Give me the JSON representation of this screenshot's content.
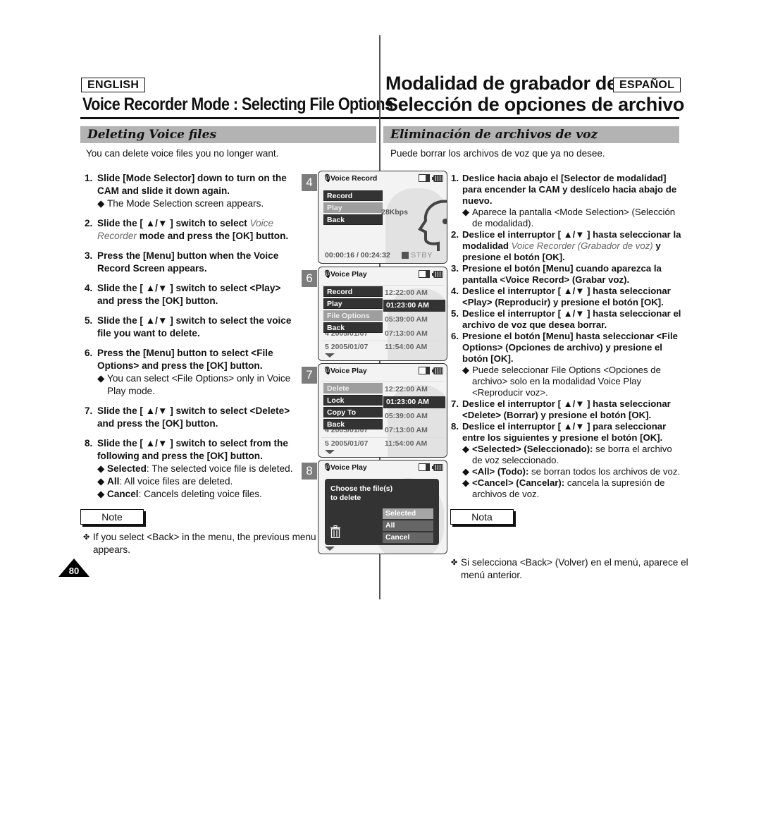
{
  "header": {
    "english_label": "ENGLISH",
    "spanish_label": "ESPAÑOL",
    "title_en": "Voice Recorder Mode : Selecting File Options",
    "title_es_line1": "Modalidad de grabador de voz:",
    "title_es_line2": "Selección de opciones de archivo"
  },
  "english": {
    "section_title": "Deleting Voice files",
    "intro": "You can delete voice files you no longer want.",
    "steps": [
      {
        "num": "1.",
        "text": "Slide [Mode Selector] down to turn on the CAM and slide it down again.",
        "bullets": [
          "The Mode Selection screen appears."
        ]
      },
      {
        "num": "2.",
        "text_pre": "Slide the [ ▲/▼ ] switch to select ",
        "text_italic": "Voice Recorder",
        "text_post": " mode and press the [OK] button."
      },
      {
        "num": "3.",
        "text": "Press the [Menu] button when the Voice Record Screen appears."
      },
      {
        "num": "4.",
        "text": "Slide the [ ▲/▼ ] switch to select <Play> and press the [OK] button."
      },
      {
        "num": "5.",
        "text": "Slide the [ ▲/▼ ] switch to select the voice file you want to delete."
      },
      {
        "num": "6.",
        "text": "Press the [Menu] button to select <File Options> and press the [OK] button.",
        "bullets": [
          "You can select <File Options> only in Voice Play mode."
        ]
      },
      {
        "num": "7.",
        "text": "Slide the [ ▲/▼ ] switch to select <Delete> and press the [OK] button."
      },
      {
        "num": "8.",
        "text": "Slide the [ ▲/▼ ] switch to select from the following and press the [OK] button.",
        "options": [
          {
            "term": "Selected",
            "desc": ": The selected voice file is deleted."
          },
          {
            "term": "All",
            "desc": ": All voice files are deleted."
          },
          {
            "term": "Cancel",
            "desc": ": Cancels deleting voice files."
          }
        ]
      }
    ],
    "note_label": "Note",
    "note_text": "If you select <Back> in the menu, the previous menu appears."
  },
  "spanish": {
    "section_title": "Eliminación de archivos de voz",
    "intro": "Puede borrar los archivos de voz que ya no desee.",
    "steps": [
      {
        "num": "1.",
        "text": "Deslice hacia abajo el [Selector de modalidad] para encender la CAM y deslícelo hacia abajo de nuevo.",
        "bullets": [
          "Aparece la pantalla <Mode Selection> (Selección de modalidad)."
        ]
      },
      {
        "num": "2.",
        "text_pre": "Deslice el interruptor [ ▲/▼ ] hasta seleccionar la modalidad ",
        "text_italic": "Voice Recorder (Grabador de voz)",
        "text_post": " y presione el botón [OK]."
      },
      {
        "num": "3.",
        "text": "Presione el botón [Menu] cuando aparezca la pantalla <Voice Record> (Grabar voz)."
      },
      {
        "num": "4.",
        "text": "Deslice el interruptor [ ▲/▼ ] hasta seleccionar <Play> (Reproducir) y presione el botón [OK]."
      },
      {
        "num": "5.",
        "text": "Deslice el interruptor [ ▲/▼ ] hasta seleccionar el archivo de voz que desea borrar."
      },
      {
        "num": "6.",
        "text": "Presione el botón [Menu] hasta seleccionar <File Options> (Opciones de archivo) y presione el botón [OK].",
        "bullets": [
          "Puede seleccionar File Options <Opciones de archivo> solo en la modalidad Voice Play <Reproducir voz>."
        ]
      },
      {
        "num": "7.",
        "text": "Deslice el interruptor [ ▲/▼ ] hasta seleccionar <Delete> (Borrar) y presione el botón [OK]."
      },
      {
        "num": "8.",
        "text": "Deslice el interruptor [ ▲/▼ ] para seleccionar entre los siguientes y presione el botón [OK].",
        "options": [
          {
            "term": "<Selected> (Seleccionado):",
            "desc": " se borra el archivo de voz seleccionado."
          },
          {
            "term": "<All> (Todo):",
            "desc": " se borran todos los archivos de voz."
          },
          {
            "term": "<Cancel> (Cancelar):",
            "desc": " cancela la supresión de archivos de voz."
          }
        ]
      }
    ],
    "note_label": "Nota",
    "note_text": "Si selecciona <Back> (Volver) en el menú, aparece el menú anterior."
  },
  "page_number": "80",
  "screens": [
    {
      "step": "4",
      "title": "Voice Record",
      "icons": [
        "mic-icon",
        "memory-card-icon",
        "battery-icon"
      ],
      "menu": [
        {
          "label": "Record",
          "selected": false
        },
        {
          "label": "Play",
          "selected": true
        },
        {
          "label": "Back",
          "selected": false
        }
      ],
      "bitrate": "28Kbps",
      "time": "00:00:16 / 00:24:32",
      "status": "STBY"
    },
    {
      "step": "6",
      "title": "Voice Play",
      "menu": [
        {
          "label": "Record",
          "selected": false
        },
        {
          "label": "Play",
          "selected": false
        },
        {
          "label": "File Options",
          "selected": true
        },
        {
          "label": "Back",
          "selected": false
        }
      ],
      "times": [
        "12:22:00 AM",
        "01:23:00 AM",
        "05:39:00 AM",
        "07:13:00 AM",
        "11:54:00 AM"
      ],
      "selected_time_index": 1,
      "partial_row": "4  2005/01/07",
      "last_row": "5  2005/01/07"
    },
    {
      "step": "7",
      "title": "Voice Play",
      "menu": [
        {
          "label": "Delete",
          "selected": true
        },
        {
          "label": "Lock",
          "selected": false
        },
        {
          "label": "Copy To",
          "selected": false
        },
        {
          "label": "Back",
          "selected": false
        }
      ],
      "times": [
        "12:22:00 AM",
        "01:23:00 AM",
        "05:39:00 AM",
        "07:13:00 AM",
        "11:54:00 AM"
      ],
      "selected_time_index": 1,
      "partial_row": "4  2005/01/07",
      "last_row": "5  2005/01/07"
    },
    {
      "step": "8",
      "title": "Voice Play",
      "dialog_line1": "Choose the file(s)",
      "dialog_line2": "to delete",
      "options": [
        {
          "label": "Selected",
          "selected": true
        },
        {
          "label": "All",
          "selected": false
        },
        {
          "label": "Cancel",
          "selected": false
        }
      ]
    }
  ]
}
